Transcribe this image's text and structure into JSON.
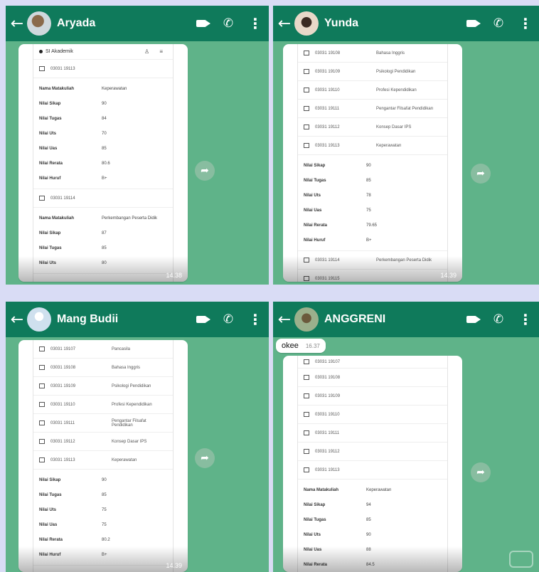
{
  "colors": {
    "header": "#0f7a5b",
    "chat_bg": "#5fb389",
    "bubble": "#ffffff"
  },
  "icons": {
    "back": "←",
    "phone": "✆",
    "menu": "⋮",
    "forward": "➦"
  },
  "panels": [
    {
      "contact": "Aryada",
      "header_title": "SI Akademik",
      "header_icons": "♙ ≡",
      "time": "14.38",
      "blocks": [
        {
          "type": "course",
          "code": "03031 19113",
          "title": ""
        },
        {
          "type": "grades",
          "rows": [
            {
              "label": "Nama Matakuliah",
              "value": "Keperawatan"
            },
            {
              "label": "Nilai Sikap",
              "value": "90"
            },
            {
              "label": "Nilai Tugas",
              "value": "84"
            },
            {
              "label": "Nilai Uts",
              "value": "70"
            },
            {
              "label": "Nilai Uas",
              "value": "85"
            },
            {
              "label": "Nilai Rerata",
              "value": "80.6"
            },
            {
              "label": "Nilai Huruf",
              "value": "B+"
            }
          ]
        },
        {
          "type": "course",
          "code": "03031 19114",
          "title": ""
        },
        {
          "type": "grades",
          "rows": [
            {
              "label": "Nama Matakuliah",
              "value": "Perkembangan Peserta Didik"
            },
            {
              "label": "Nilai Sikap",
              "value": "87"
            },
            {
              "label": "Nilai Tugas",
              "value": "85"
            },
            {
              "label": "Nilai Uts",
              "value": "80"
            }
          ]
        }
      ]
    },
    {
      "contact": "Yunda",
      "time": "14.39",
      "blocks": [
        {
          "type": "course",
          "code": "03031 19108",
          "title": "Bahasa Inggris"
        },
        {
          "type": "course",
          "code": "03031 19109",
          "title": "Psikologi Pendidikan"
        },
        {
          "type": "course",
          "code": "03031 19110",
          "title": "Profesi Kependidikan"
        },
        {
          "type": "course",
          "code": "03031 19111",
          "title": "Pengantar Filsafat Pendidikan"
        },
        {
          "type": "course",
          "code": "03031 19112",
          "title": "Konsep Dasar IPS"
        },
        {
          "type": "course",
          "code": "03031 19113",
          "title": "Keperawatan"
        },
        {
          "type": "grades",
          "rows": [
            {
              "label": "Nilai Sikap",
              "value": "90"
            },
            {
              "label": "Nilai Tugas",
              "value": "85"
            },
            {
              "label": "Nilai Uts",
              "value": "78"
            },
            {
              "label": "Nilai Uas",
              "value": "75"
            },
            {
              "label": "Nilai Rerata",
              "value": "79.65"
            },
            {
              "label": "Nilai Huruf",
              "value": "B+"
            }
          ]
        },
        {
          "type": "course",
          "code": "03031 19114",
          "title": "Perkembangan Peserta Didik"
        },
        {
          "type": "course",
          "code": "03031 19115",
          "title": ""
        }
      ]
    },
    {
      "contact": "Mang Budii",
      "time": "14.39",
      "blocks": [
        {
          "type": "course",
          "code": "03031 19107",
          "title": "Pancasila"
        },
        {
          "type": "course",
          "code": "03031 19108",
          "title": "Bahasa Inggris"
        },
        {
          "type": "course",
          "code": "03031 19109",
          "title": "Psikologi Pendidikan"
        },
        {
          "type": "course",
          "code": "03031 19110",
          "title": "Profesi Kependidikan"
        },
        {
          "type": "course",
          "code": "03031 19111",
          "title": "Pengantar Filsafat Pendidikan"
        },
        {
          "type": "course",
          "code": "03031 19112",
          "title": "Konsep Dasar IPS"
        },
        {
          "type": "course",
          "code": "03031 19113",
          "title": "Keperawatan"
        },
        {
          "type": "grades",
          "rows": [
            {
              "label": "Nilai Sikap",
              "value": "90"
            },
            {
              "label": "Nilai Tugas",
              "value": "85"
            },
            {
              "label": "Nilai Uts",
              "value": "75"
            },
            {
              "label": "Nilai Uas",
              "value": "75"
            },
            {
              "label": "Nilai Rerata",
              "value": "80.2"
            },
            {
              "label": "Nilai Huruf",
              "value": "B+"
            }
          ]
        }
      ]
    },
    {
      "contact": "ANGGRENI",
      "message": {
        "text": "okee",
        "time": "16.37"
      },
      "blocks": [
        {
          "type": "course",
          "code": "03031 19107",
          "title": ""
        },
        {
          "type": "course",
          "code": "03031 19108",
          "title": ""
        },
        {
          "type": "course",
          "code": "03031 19109",
          "title": ""
        },
        {
          "type": "course",
          "code": "03031 19110",
          "title": ""
        },
        {
          "type": "course",
          "code": "03031 19111",
          "title": ""
        },
        {
          "type": "course",
          "code": "03031 19112",
          "title": ""
        },
        {
          "type": "course",
          "code": "03031 19113",
          "title": ""
        },
        {
          "type": "grades",
          "rows": [
            {
              "label": "Nama Matakuliah",
              "value": "Keperawatan"
            },
            {
              "label": "Nilai Sikap",
              "value": "94"
            },
            {
              "label": "Nilai Tugas",
              "value": "85"
            },
            {
              "label": "Nilai Uts",
              "value": "90"
            },
            {
              "label": "Nilai Uas",
              "value": "88"
            },
            {
              "label": "Nilai Rerata",
              "value": "84.5"
            }
          ]
        }
      ]
    }
  ]
}
